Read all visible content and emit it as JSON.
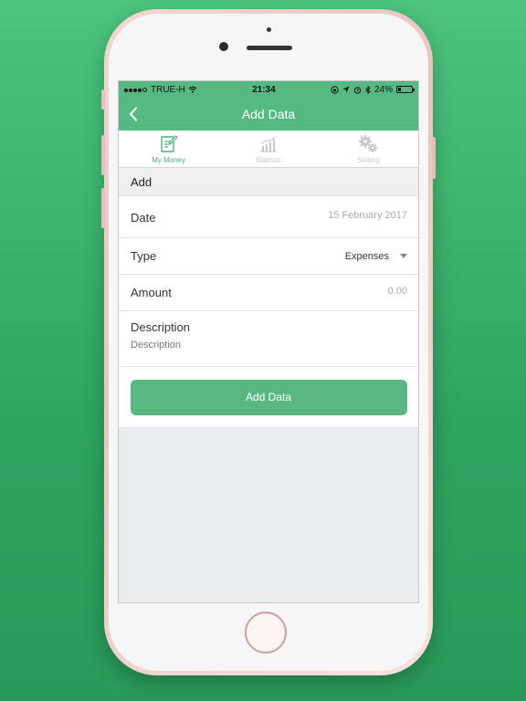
{
  "status_bar": {
    "carrier": "TRUE-H",
    "time": "21:34",
    "battery": "24%",
    "battery_level": 0.24
  },
  "nav": {
    "title": "Add Data",
    "back_icon": "chevron-left-icon"
  },
  "tabs": [
    {
      "label": "My Money",
      "icon": "notepad-pencil-icon",
      "active": true
    },
    {
      "label": "Statistic",
      "icon": "bar-chart-icon",
      "active": false
    },
    {
      "label": "Setting",
      "icon": "gears-icon",
      "active": false
    }
  ],
  "form": {
    "section_title": "Add",
    "date_label": "Date",
    "date_value": "15 February 2017",
    "type_label": "Type",
    "type_value": "Expenses",
    "amount_label": "Amount",
    "amount_placeholder": "0.00",
    "description_label": "Description",
    "description_placeholder": "Description",
    "submit_label": "Add Data"
  },
  "colors": {
    "background": "#3cb56f",
    "accent": "#55b981",
    "button": "#59b882",
    "phone_frame": "#f1d3cf"
  }
}
